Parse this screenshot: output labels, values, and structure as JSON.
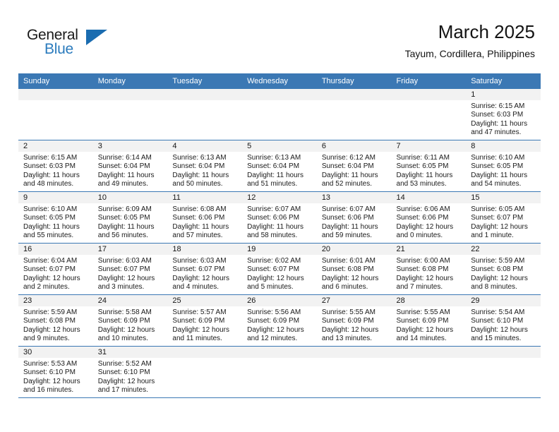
{
  "brand": {
    "name_part1": "General",
    "name_part2": "Blue",
    "triangle_icon": "triangle-icon",
    "color_primary": "#1a6cb0",
    "color_text": "#2b7bbd"
  },
  "header": {
    "title": "March 2025",
    "subtitle": "Tayum, Cordillera, Philippines"
  },
  "theme": {
    "header_blue": "#3b78b4",
    "daynum_band": "#f2f2f2",
    "text": "#1a1a1a"
  },
  "weekdays": [
    "Sunday",
    "Monday",
    "Tuesday",
    "Wednesday",
    "Thursday",
    "Friday",
    "Saturday"
  ],
  "labels": {
    "sunrise_prefix": "Sunrise:",
    "sunset_prefix": "Sunset:",
    "daylight_prefix": "Daylight:"
  },
  "weeks": [
    [
      {
        "empty": true
      },
      {
        "empty": true
      },
      {
        "empty": true
      },
      {
        "empty": true
      },
      {
        "empty": true
      },
      {
        "empty": true
      },
      {
        "day": "1",
        "line1": "Sunrise: 6:15 AM",
        "line2": "Sunset: 6:03 PM",
        "line3": "Daylight: 11 hours",
        "line4": "and 47 minutes."
      }
    ],
    [
      {
        "day": "2",
        "line1": "Sunrise: 6:15 AM",
        "line2": "Sunset: 6:03 PM",
        "line3": "Daylight: 11 hours",
        "line4": "and 48 minutes."
      },
      {
        "day": "3",
        "line1": "Sunrise: 6:14 AM",
        "line2": "Sunset: 6:04 PM",
        "line3": "Daylight: 11 hours",
        "line4": "and 49 minutes."
      },
      {
        "day": "4",
        "line1": "Sunrise: 6:13 AM",
        "line2": "Sunset: 6:04 PM",
        "line3": "Daylight: 11 hours",
        "line4": "and 50 minutes."
      },
      {
        "day": "5",
        "line1": "Sunrise: 6:13 AM",
        "line2": "Sunset: 6:04 PM",
        "line3": "Daylight: 11 hours",
        "line4": "and 51 minutes."
      },
      {
        "day": "6",
        "line1": "Sunrise: 6:12 AM",
        "line2": "Sunset: 6:04 PM",
        "line3": "Daylight: 11 hours",
        "line4": "and 52 minutes."
      },
      {
        "day": "7",
        "line1": "Sunrise: 6:11 AM",
        "line2": "Sunset: 6:05 PM",
        "line3": "Daylight: 11 hours",
        "line4": "and 53 minutes."
      },
      {
        "day": "8",
        "line1": "Sunrise: 6:10 AM",
        "line2": "Sunset: 6:05 PM",
        "line3": "Daylight: 11 hours",
        "line4": "and 54 minutes."
      }
    ],
    [
      {
        "day": "9",
        "line1": "Sunrise: 6:10 AM",
        "line2": "Sunset: 6:05 PM",
        "line3": "Daylight: 11 hours",
        "line4": "and 55 minutes."
      },
      {
        "day": "10",
        "line1": "Sunrise: 6:09 AM",
        "line2": "Sunset: 6:05 PM",
        "line3": "Daylight: 11 hours",
        "line4": "and 56 minutes."
      },
      {
        "day": "11",
        "line1": "Sunrise: 6:08 AM",
        "line2": "Sunset: 6:06 PM",
        "line3": "Daylight: 11 hours",
        "line4": "and 57 minutes."
      },
      {
        "day": "12",
        "line1": "Sunrise: 6:07 AM",
        "line2": "Sunset: 6:06 PM",
        "line3": "Daylight: 11 hours",
        "line4": "and 58 minutes."
      },
      {
        "day": "13",
        "line1": "Sunrise: 6:07 AM",
        "line2": "Sunset: 6:06 PM",
        "line3": "Daylight: 11 hours",
        "line4": "and 59 minutes."
      },
      {
        "day": "14",
        "line1": "Sunrise: 6:06 AM",
        "line2": "Sunset: 6:06 PM",
        "line3": "Daylight: 12 hours",
        "line4": "and 0 minutes."
      },
      {
        "day": "15",
        "line1": "Sunrise: 6:05 AM",
        "line2": "Sunset: 6:07 PM",
        "line3": "Daylight: 12 hours",
        "line4": "and 1 minute."
      }
    ],
    [
      {
        "day": "16",
        "line1": "Sunrise: 6:04 AM",
        "line2": "Sunset: 6:07 PM",
        "line3": "Daylight: 12 hours",
        "line4": "and 2 minutes."
      },
      {
        "day": "17",
        "line1": "Sunrise: 6:03 AM",
        "line2": "Sunset: 6:07 PM",
        "line3": "Daylight: 12 hours",
        "line4": "and 3 minutes."
      },
      {
        "day": "18",
        "line1": "Sunrise: 6:03 AM",
        "line2": "Sunset: 6:07 PM",
        "line3": "Daylight: 12 hours",
        "line4": "and 4 minutes."
      },
      {
        "day": "19",
        "line1": "Sunrise: 6:02 AM",
        "line2": "Sunset: 6:07 PM",
        "line3": "Daylight: 12 hours",
        "line4": "and 5 minutes."
      },
      {
        "day": "20",
        "line1": "Sunrise: 6:01 AM",
        "line2": "Sunset: 6:08 PM",
        "line3": "Daylight: 12 hours",
        "line4": "and 6 minutes."
      },
      {
        "day": "21",
        "line1": "Sunrise: 6:00 AM",
        "line2": "Sunset: 6:08 PM",
        "line3": "Daylight: 12 hours",
        "line4": "and 7 minutes."
      },
      {
        "day": "22",
        "line1": "Sunrise: 5:59 AM",
        "line2": "Sunset: 6:08 PM",
        "line3": "Daylight: 12 hours",
        "line4": "and 8 minutes."
      }
    ],
    [
      {
        "day": "23",
        "line1": "Sunrise: 5:59 AM",
        "line2": "Sunset: 6:08 PM",
        "line3": "Daylight: 12 hours",
        "line4": "and 9 minutes."
      },
      {
        "day": "24",
        "line1": "Sunrise: 5:58 AM",
        "line2": "Sunset: 6:09 PM",
        "line3": "Daylight: 12 hours",
        "line4": "and 10 minutes."
      },
      {
        "day": "25",
        "line1": "Sunrise: 5:57 AM",
        "line2": "Sunset: 6:09 PM",
        "line3": "Daylight: 12 hours",
        "line4": "and 11 minutes."
      },
      {
        "day": "26",
        "line1": "Sunrise: 5:56 AM",
        "line2": "Sunset: 6:09 PM",
        "line3": "Daylight: 12 hours",
        "line4": "and 12 minutes."
      },
      {
        "day": "27",
        "line1": "Sunrise: 5:55 AM",
        "line2": "Sunset: 6:09 PM",
        "line3": "Daylight: 12 hours",
        "line4": "and 13 minutes."
      },
      {
        "day": "28",
        "line1": "Sunrise: 5:55 AM",
        "line2": "Sunset: 6:09 PM",
        "line3": "Daylight: 12 hours",
        "line4": "and 14 minutes."
      },
      {
        "day": "29",
        "line1": "Sunrise: 5:54 AM",
        "line2": "Sunset: 6:10 PM",
        "line3": "Daylight: 12 hours",
        "line4": "and 15 minutes."
      }
    ],
    [
      {
        "day": "30",
        "line1": "Sunrise: 5:53 AM",
        "line2": "Sunset: 6:10 PM",
        "line3": "Daylight: 12 hours",
        "line4": "and 16 minutes."
      },
      {
        "day": "31",
        "line1": "Sunrise: 5:52 AM",
        "line2": "Sunset: 6:10 PM",
        "line3": "Daylight: 12 hours",
        "line4": "and 17 minutes."
      },
      {
        "empty": true
      },
      {
        "empty": true
      },
      {
        "empty": true
      },
      {
        "empty": true
      },
      {
        "empty": true
      }
    ]
  ]
}
